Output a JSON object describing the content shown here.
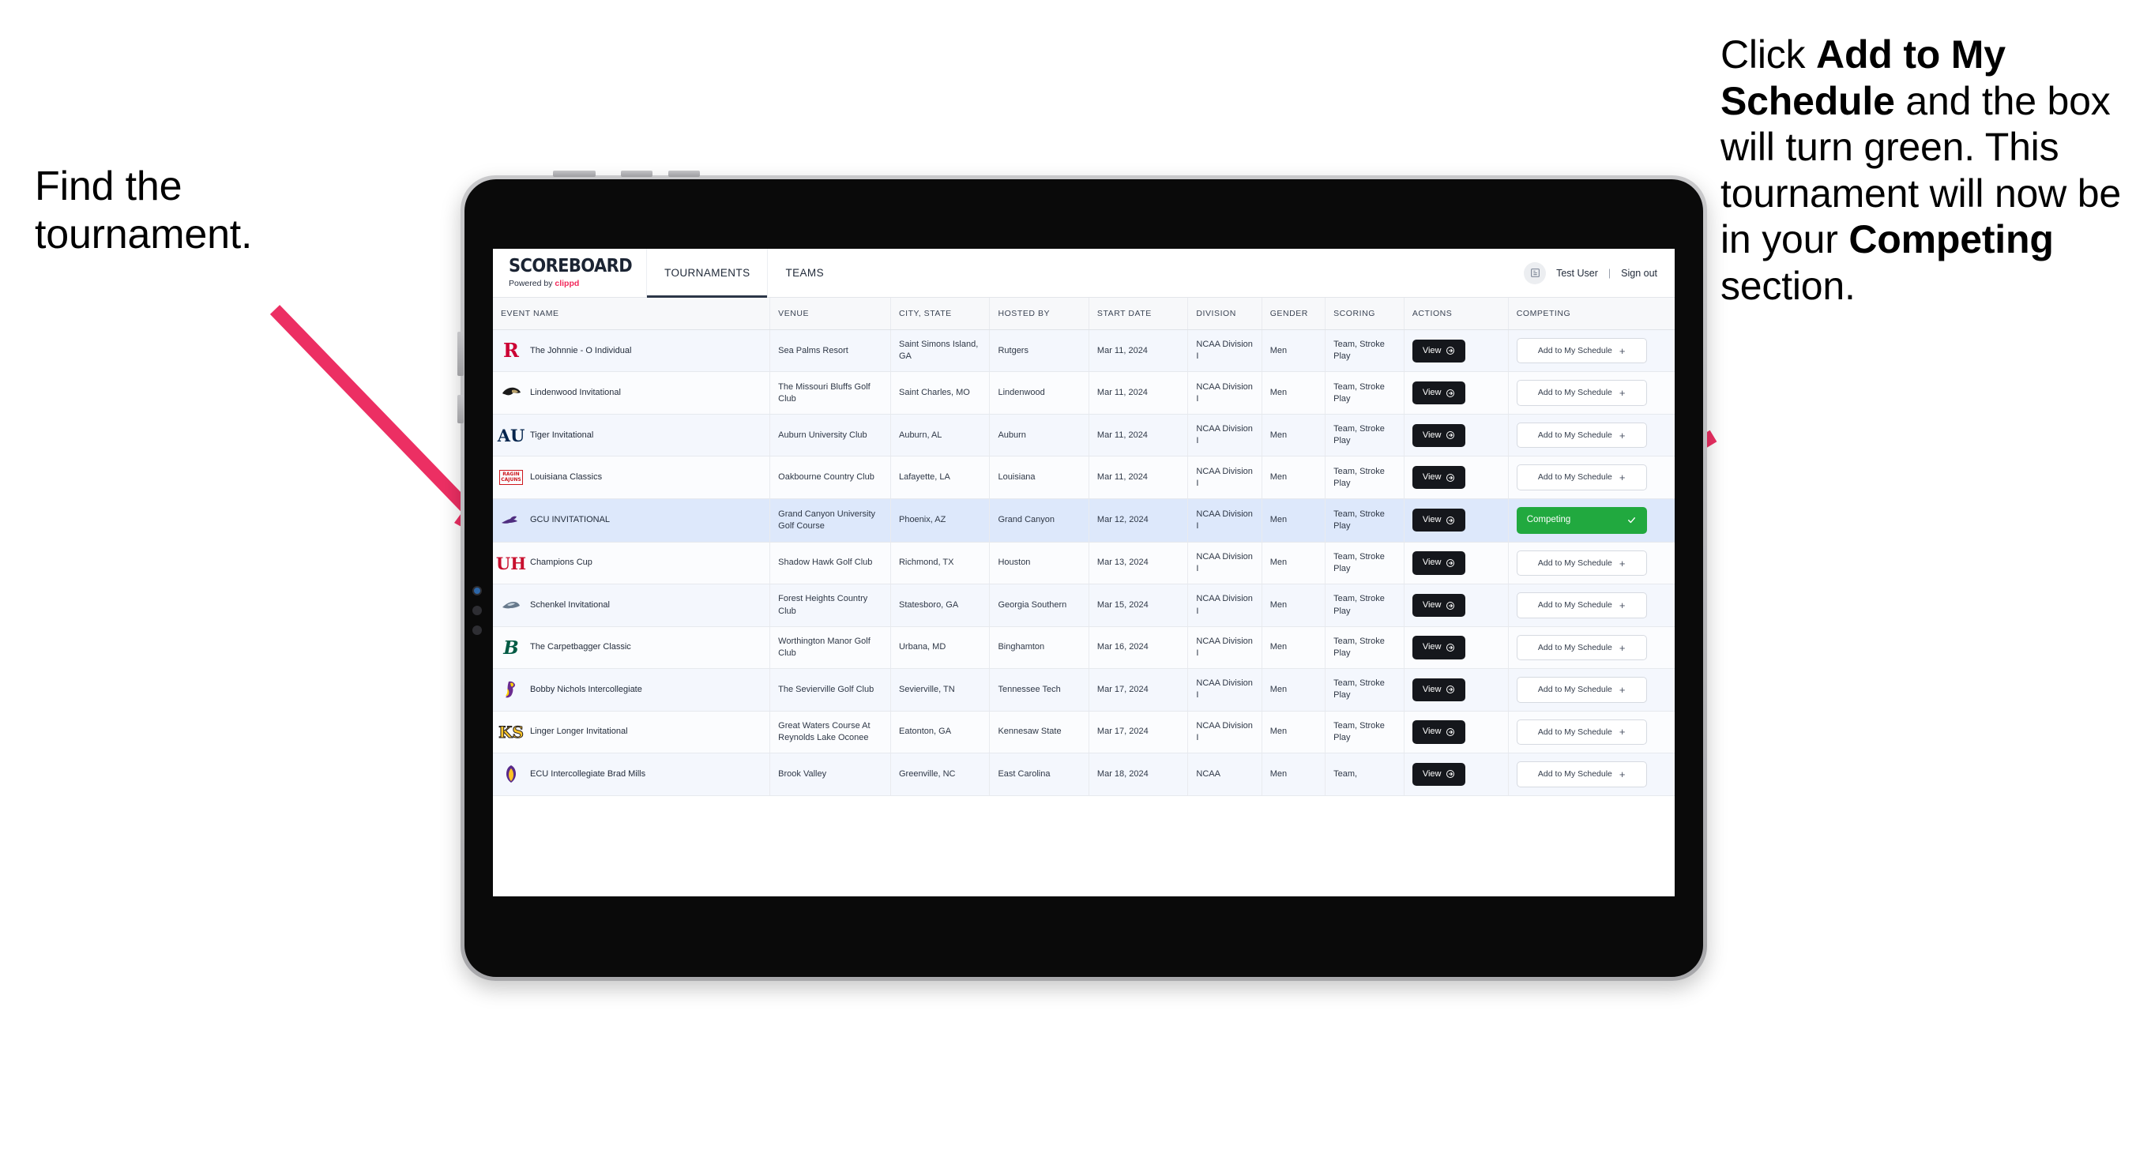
{
  "annotations": {
    "left": "Find the tournament.",
    "right_parts": [
      {
        "text": "Click ",
        "bold": false
      },
      {
        "text": "Add to My Schedule",
        "bold": true
      },
      {
        "text": " and the box will turn green. This tournament will now be in your ",
        "bold": false
      },
      {
        "text": "Competing",
        "bold": true
      },
      {
        "text": " section.",
        "bold": false
      }
    ],
    "arrow_color": "#ec2f63"
  },
  "app": {
    "brand": {
      "title": "SCOREBOARD",
      "powered_prefix": "Powered by ",
      "powered_brand": "clippd"
    },
    "nav_tabs": [
      {
        "label": "TOURNAMENTS",
        "active": true
      },
      {
        "label": "TEAMS",
        "active": false
      }
    ],
    "account": {
      "avatar_icon": "user-badge-icon",
      "user": "Test User",
      "separator": "|",
      "signout": "Sign out"
    },
    "table": {
      "columns": [
        "EVENT NAME",
        "VENUE",
        "CITY, STATE",
        "HOSTED BY",
        "START DATE",
        "DIVISION",
        "GENDER",
        "SCORING",
        "ACTIONS",
        "COMPETING"
      ],
      "action_label": "View",
      "add_label": "Add to My Schedule",
      "add_plus": "+",
      "competing_label": "Competing",
      "rows": [
        {
          "logo": "rutgers-r-logo",
          "event": "The Johnnie - O Individual",
          "venue": "Sea Palms Resort",
          "city": "Saint Simons Island, GA",
          "hosted_by": "Rutgers",
          "start_date": "Mar 11, 2024",
          "division": "NCAA Division I",
          "gender": "Men",
          "scoring": "Team, Stroke Play",
          "competing": false,
          "highlight": false
        },
        {
          "logo": "lindenwood-lion-logo",
          "event": "Lindenwood Invitational",
          "venue": "The Missouri Bluffs Golf Club",
          "city": "Saint Charles, MO",
          "hosted_by": "Lindenwood",
          "start_date": "Mar 11, 2024",
          "division": "NCAA Division I",
          "gender": "Men",
          "scoring": "Team, Stroke Play",
          "competing": false,
          "highlight": false
        },
        {
          "logo": "auburn-au-logo",
          "event": "Tiger Invitational",
          "venue": "Auburn University Club",
          "city": "Auburn, AL",
          "hosted_by": "Auburn",
          "start_date": "Mar 11, 2024",
          "division": "NCAA Division I",
          "gender": "Men",
          "scoring": "Team, Stroke Play",
          "competing": false,
          "highlight": false
        },
        {
          "logo": "ragin-cajuns-logo",
          "event": "Louisiana Classics",
          "venue": "Oakbourne Country Club",
          "city": "Lafayette, LA",
          "hosted_by": "Louisiana",
          "start_date": "Mar 11, 2024",
          "division": "NCAA Division I",
          "gender": "Men",
          "scoring": "Team, Stroke Play",
          "competing": false,
          "highlight": false
        },
        {
          "logo": "gcu-lope-logo",
          "event": "GCU INVITATIONAL",
          "venue": "Grand Canyon University Golf Course",
          "city": "Phoenix, AZ",
          "hosted_by": "Grand Canyon",
          "start_date": "Mar 12, 2024",
          "division": "NCAA Division I",
          "gender": "Men",
          "scoring": "Team, Stroke Play",
          "competing": true,
          "highlight": true
        },
        {
          "logo": "houston-uh-logo",
          "event": "Champions Cup",
          "venue": "Shadow Hawk Golf Club",
          "city": "Richmond, TX",
          "hosted_by": "Houston",
          "start_date": "Mar 13, 2024",
          "division": "NCAA Division I",
          "gender": "Men",
          "scoring": "Team, Stroke Play",
          "competing": false,
          "highlight": false
        },
        {
          "logo": "georgia-southern-eagle-logo",
          "event": "Schenkel Invitational",
          "venue": "Forest Heights Country Club",
          "city": "Statesboro, GA",
          "hosted_by": "Georgia Southern",
          "start_date": "Mar 15, 2024",
          "division": "NCAA Division I",
          "gender": "Men",
          "scoring": "Team, Stroke Play",
          "competing": false,
          "highlight": false
        },
        {
          "logo": "binghamton-b-logo",
          "event": "The Carpetbagger Classic",
          "venue": "Worthington Manor Golf Club",
          "city": "Urbana, MD",
          "hosted_by": "Binghamton",
          "start_date": "Mar 16, 2024",
          "division": "NCAA Division I",
          "gender": "Men",
          "scoring": "Team, Stroke Play",
          "competing": false,
          "highlight": false
        },
        {
          "logo": "tennessee-tech-eagle-logo",
          "event": "Bobby Nichols Intercollegiate",
          "venue": "The Sevierville Golf Club",
          "city": "Sevierville, TN",
          "hosted_by": "Tennessee Tech",
          "start_date": "Mar 17, 2024",
          "division": "NCAA Division I",
          "gender": "Men",
          "scoring": "Team, Stroke Play",
          "competing": false,
          "highlight": false
        },
        {
          "logo": "kennesaw-state-ksu-logo",
          "event": "Linger Longer Invitational",
          "venue": "Great Waters Course At Reynolds Lake Oconee",
          "city": "Eatonton, GA",
          "hosted_by": "Kennesaw State",
          "start_date": "Mar 17, 2024",
          "division": "NCAA Division I",
          "gender": "Men",
          "scoring": "Team, Stroke Play",
          "competing": false,
          "highlight": false
        },
        {
          "logo": "east-carolina-logo",
          "event": "ECU Intercollegiate Brad Mills",
          "venue": "Brook Valley",
          "city": "Greenville, NC",
          "hosted_by": "East Carolina",
          "start_date": "Mar 18, 2024",
          "division": "NCAA",
          "gender": "Men",
          "scoring": "Team,",
          "competing": false,
          "highlight": false
        }
      ]
    }
  }
}
